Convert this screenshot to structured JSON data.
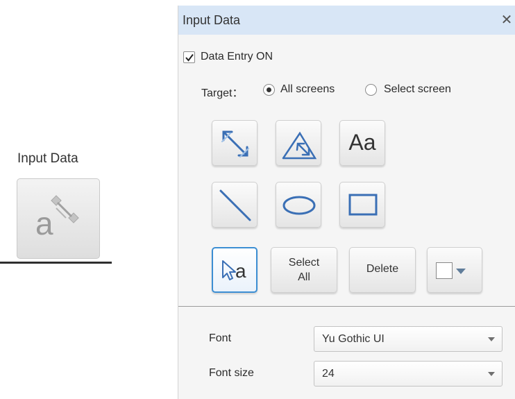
{
  "ribbon": {
    "label": "Input Data"
  },
  "panel": {
    "title": "Input Data",
    "close_symbol": "✕",
    "data_entry": {
      "label": "Data Entry ON",
      "checked": true
    },
    "target": {
      "label": "Target：",
      "options": [
        {
          "label": "All screens",
          "selected": true
        },
        {
          "label": "Select screen",
          "selected": false
        }
      ]
    },
    "tools": {
      "text_label": "Aa",
      "pointer_text": "a"
    },
    "actions": {
      "select_all_line1": "Select",
      "select_all_line2": "All",
      "delete": "Delete",
      "color_value": "#ffffff"
    },
    "font": {
      "label": "Font",
      "value": "Yu Gothic UI"
    },
    "font_size": {
      "label": "Font size",
      "value": "24"
    },
    "colors": {
      "accent": "#3c8ed3",
      "header": "#d8e6f6",
      "tool_stroke": "#3a6fb5"
    }
  }
}
